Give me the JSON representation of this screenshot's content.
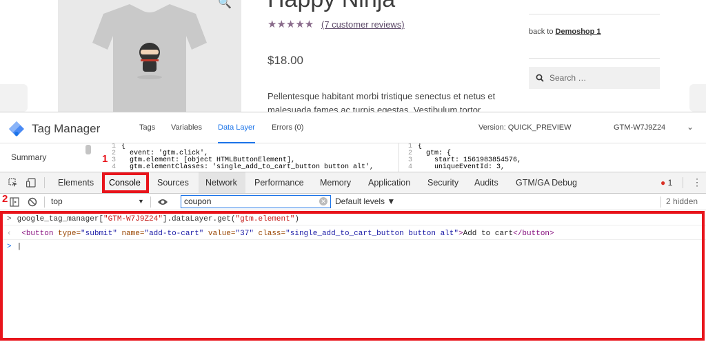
{
  "webpage": {
    "product_title": "Happy Ninja",
    "stars": "★★★★★",
    "reviews_link": "(7 customer reviews)",
    "price": "$18.00",
    "description": "Pellentesque habitant morbi tristique senectus et netus et malesuada fames ac turpis egestas. Vestibulum tortor quam,",
    "back_prefix": "back to ",
    "back_link": "Demoshop 1",
    "search_placeholder": "Search …",
    "zoom_icon": "🔍"
  },
  "tag_manager": {
    "title": "Tag Manager",
    "tabs": [
      "Tags",
      "Variables",
      "Data Layer",
      "Errors (0)"
    ],
    "active_tab": "Data Layer",
    "version": "Version: QUICK_PREVIEW",
    "container_id": "GTM-W7J9Z24",
    "chevron": "⌄"
  },
  "data_layer": {
    "summary": "Summary",
    "left_code": [
      {
        "n": "1",
        "t": "{"
      },
      {
        "n": "2",
        "t": "  event: 'gtm.click',"
      },
      {
        "n": "3",
        "t": "  gtm.element: [object HTMLButtonElement],"
      },
      {
        "n": "4",
        "t": "  gtm.elementClasses: 'single_add_to_cart_button button alt',"
      }
    ],
    "right_code": [
      {
        "n": "1",
        "t": "{"
      },
      {
        "n": "2",
        "t": "  gtm: {"
      },
      {
        "n": "3",
        "t": "    start: 1561983854576,"
      },
      {
        "n": "4",
        "t": "    uniqueEventId: 3,"
      }
    ]
  },
  "devtools": {
    "tabs": [
      "Elements",
      "Console",
      "Sources",
      "Network",
      "Performance",
      "Memory",
      "Application",
      "Security",
      "Audits",
      "GTM/GA Debug"
    ],
    "selected_tab": "Console",
    "error_count": "1",
    "context": "top",
    "filter_value": "coupon",
    "levels": "Default levels ▼",
    "hidden": "2 hidden"
  },
  "console": {
    "input_prefix": "google_tag_manager[",
    "input_string": "\"GTM-W7J9Z24\"",
    "input_suffix": "].dataLayer.get(",
    "input_arg": "\"gtm.element\"",
    "input_end": ")",
    "output": {
      "open": "<button",
      "a1": " type=",
      "v1": "\"submit\"",
      "a2": " name=",
      "v2": "\"add-to-cart\"",
      "a3": " value=",
      "v3": "\"37\"",
      "a4": " class=",
      "v4": "\"single_add_to_cart_button button alt\"",
      "gt": ">",
      "text": "Add to cart",
      "close": "</button>"
    }
  },
  "annotations": {
    "label_1": "1",
    "label_2": "2",
    "color": "#e8141b"
  }
}
